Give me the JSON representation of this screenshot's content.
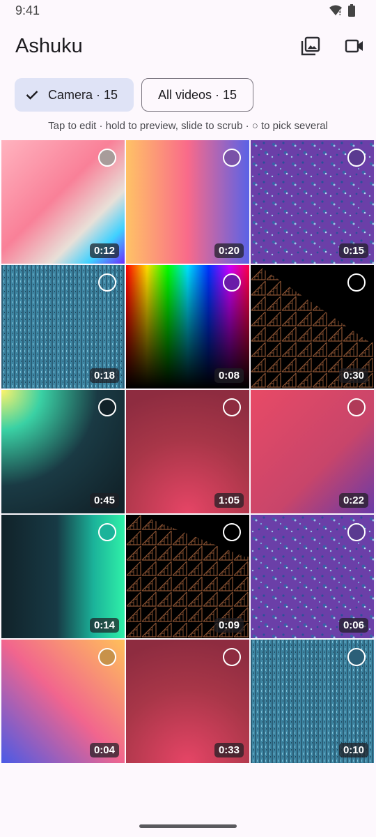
{
  "status": {
    "time": "9:41"
  },
  "header": {
    "title": "Ashuku"
  },
  "chips": [
    {
      "label": "Camera · 15",
      "selected": true
    },
    {
      "label": "All videos · 15",
      "selected": false
    }
  ],
  "hint": "Tap to edit · hold to preview, slide to scrub · ○ to pick several",
  "videos": [
    {
      "duration": "0:12"
    },
    {
      "duration": "0:20"
    },
    {
      "duration": "0:15"
    },
    {
      "duration": "0:18"
    },
    {
      "duration": "0:08"
    },
    {
      "duration": "0:30"
    },
    {
      "duration": "0:45"
    },
    {
      "duration": "1:05"
    },
    {
      "duration": "0:22"
    },
    {
      "duration": "0:14"
    },
    {
      "duration": "0:09"
    },
    {
      "duration": "0:06"
    },
    {
      "duration": "0:04"
    },
    {
      "duration": "0:33"
    },
    {
      "duration": "0:10"
    }
  ]
}
